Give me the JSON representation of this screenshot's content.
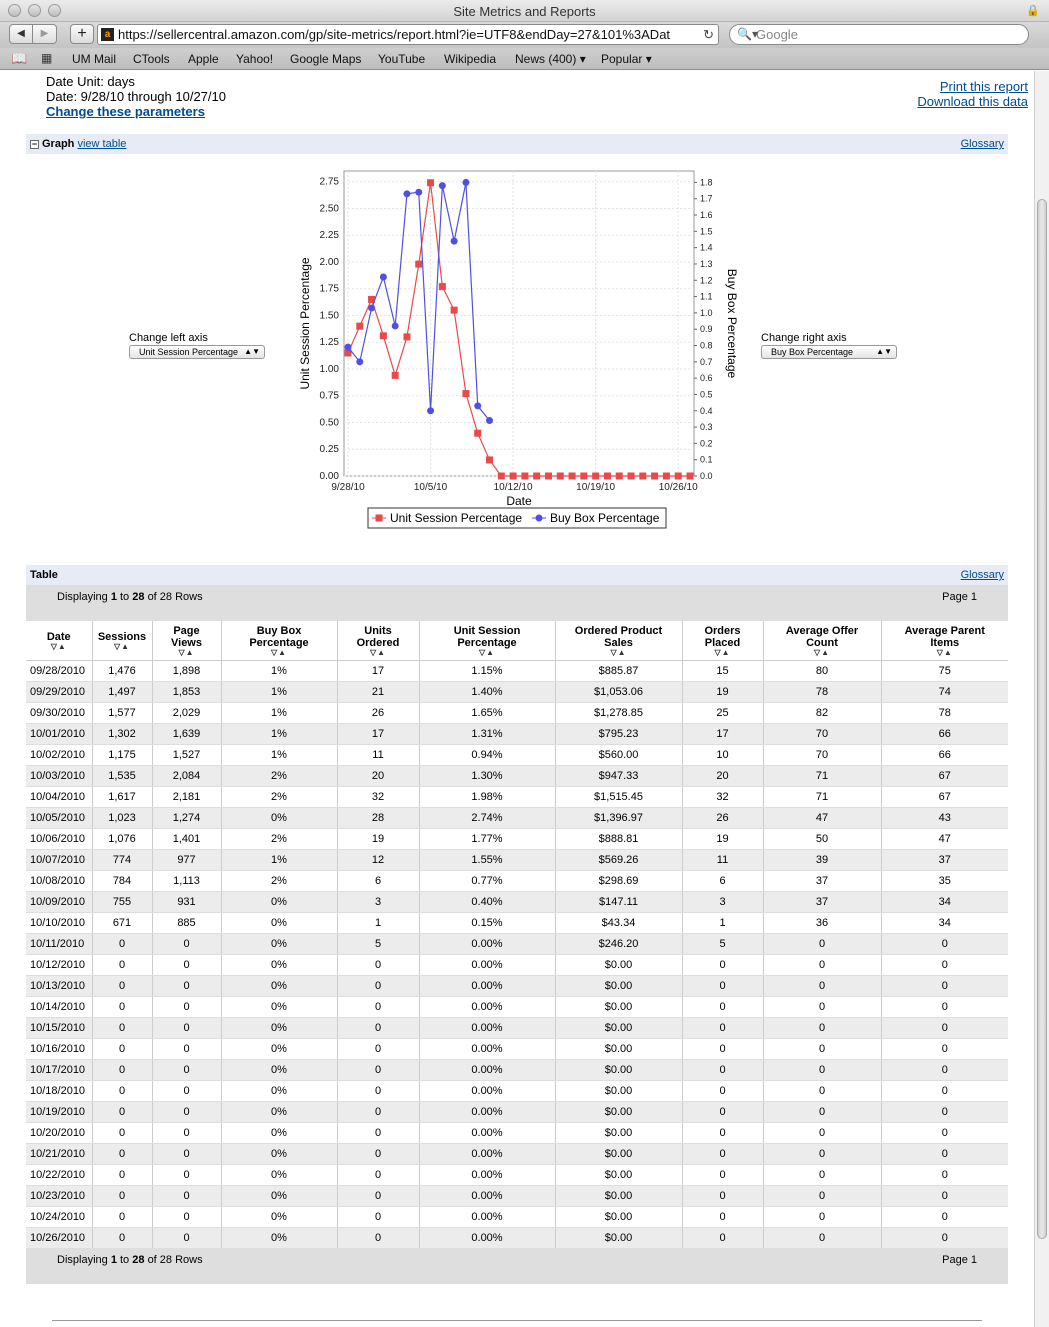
{
  "window": {
    "title": "Site Metrics and Reports"
  },
  "toolbar": {
    "url": "https://sellercentral.amazon.com/gp/site-metrics/report.html?ie=UTF8&endDay=27&101%3ADat",
    "search_placeholder": "Google",
    "back_icon": "back-arrow-icon",
    "forward_icon": "forward-arrow-icon"
  },
  "bookmarks": [
    "UM Mail",
    "CTools",
    "Apple",
    "Yahoo!",
    "Google Maps",
    "YouTube",
    "Wikipedia",
    "News (400) ▾",
    "Popular ▾"
  ],
  "params": {
    "date_unit": "Date Unit: days",
    "date_range": "Date: 9/28/10 through 10/27/10",
    "change_link": "Change these parameters"
  },
  "links": {
    "print": "Print this report",
    "download": "Download this data"
  },
  "graph": {
    "title": "Graph",
    "view_table": "view table",
    "glossary": "Glossary",
    "left_axis_label": "Change left axis",
    "left_axis_value": "Unit Session Percentage",
    "right_axis_label": "Change right axis",
    "right_axis_value": "Buy Box Percentage"
  },
  "chart_data": {
    "type": "line",
    "xlabel": "Date",
    "ylabel": "Unit Session Percentage",
    "y2label": "Buy Box Percentage",
    "x_ticks": [
      "9/28/10",
      "10/5/10",
      "10/12/10",
      "10/19/10",
      "10/26/10"
    ],
    "y_ticks": [
      "0.00",
      "0.25",
      "0.50",
      "0.75",
      "1.00",
      "1.25",
      "1.50",
      "1.75",
      "2.00",
      "2.25",
      "2.50",
      "2.75"
    ],
    "y2_ticks": [
      "0.0",
      "0.1",
      "0.2",
      "0.3",
      "0.4",
      "0.5",
      "0.6",
      "0.7",
      "0.8",
      "0.9",
      "1.0",
      "1.1",
      "1.2",
      "1.3",
      "1.4",
      "1.5",
      "1.6",
      "1.7",
      "1.8"
    ],
    "ylim": [
      0,
      2.85
    ],
    "y2lim": [
      0,
      1.87
    ],
    "x_days": 29,
    "grid": true,
    "legend": "bottom",
    "series": [
      {
        "name": "Unit Session Percentage",
        "axis": "left",
        "color": "#e84a4a",
        "marker": "square",
        "values": [
          1.15,
          1.4,
          1.65,
          1.31,
          0.94,
          1.3,
          1.98,
          2.74,
          1.77,
          1.55,
          0.77,
          0.4,
          0.15,
          0,
          0,
          0,
          0,
          0,
          0,
          0,
          0,
          0,
          0,
          0,
          0,
          0,
          0,
          0,
          0,
          0
        ]
      },
      {
        "name": "Buy Box Percentage",
        "axis": "right",
        "color": "#5050e0",
        "marker": "circle",
        "values": [
          0.79,
          0.7,
          1.03,
          1.22,
          0.92,
          1.73,
          1.74,
          0.4,
          1.78,
          1.44,
          1.8,
          0.43,
          0.34
        ]
      }
    ]
  },
  "table": {
    "title": "Table",
    "glossary": "Glossary",
    "display_prefix": "Displaying",
    "display_from": "1",
    "display_to_word": "to",
    "display_to": "28",
    "display_of": "of 28 Rows",
    "page": "Page 1",
    "headers": [
      [
        "Date"
      ],
      [
        "Sessions"
      ],
      [
        "Page",
        "Views"
      ],
      [
        "Buy Box",
        "Percentage"
      ],
      [
        "Units",
        "Ordered"
      ],
      [
        "Unit Session",
        "Percentage"
      ],
      [
        "Ordered Product",
        "Sales"
      ],
      [
        "Orders",
        "Placed"
      ],
      [
        "Average Offer",
        "Count"
      ],
      [
        "Average Parent",
        "Items"
      ]
    ],
    "rows": [
      [
        "09/28/2010",
        "1,476",
        "1,898",
        "1%",
        "17",
        "1.15%",
        "$885.87",
        "15",
        "80",
        "75"
      ],
      [
        "09/29/2010",
        "1,497",
        "1,853",
        "1%",
        "21",
        "1.40%",
        "$1,053.06",
        "19",
        "78",
        "74"
      ],
      [
        "09/30/2010",
        "1,577",
        "2,029",
        "1%",
        "26",
        "1.65%",
        "$1,278.85",
        "25",
        "82",
        "78"
      ],
      [
        "10/01/2010",
        "1,302",
        "1,639",
        "1%",
        "17",
        "1.31%",
        "$795.23",
        "17",
        "70",
        "66"
      ],
      [
        "10/02/2010",
        "1,175",
        "1,527",
        "1%",
        "11",
        "0.94%",
        "$560.00",
        "10",
        "70",
        "66"
      ],
      [
        "10/03/2010",
        "1,535",
        "2,084",
        "2%",
        "20",
        "1.30%",
        "$947.33",
        "20",
        "71",
        "67"
      ],
      [
        "10/04/2010",
        "1,617",
        "2,181",
        "2%",
        "32",
        "1.98%",
        "$1,515.45",
        "32",
        "71",
        "67"
      ],
      [
        "10/05/2010",
        "1,023",
        "1,274",
        "0%",
        "28",
        "2.74%",
        "$1,396.97",
        "26",
        "47",
        "43"
      ],
      [
        "10/06/2010",
        "1,076",
        "1,401",
        "2%",
        "19",
        "1.77%",
        "$888.81",
        "19",
        "50",
        "47"
      ],
      [
        "10/07/2010",
        "774",
        "977",
        "1%",
        "12",
        "1.55%",
        "$569.26",
        "11",
        "39",
        "37"
      ],
      [
        "10/08/2010",
        "784",
        "1,113",
        "2%",
        "6",
        "0.77%",
        "$298.69",
        "6",
        "37",
        "35"
      ],
      [
        "10/09/2010",
        "755",
        "931",
        "0%",
        "3",
        "0.40%",
        "$147.11",
        "3",
        "37",
        "34"
      ],
      [
        "10/10/2010",
        "671",
        "885",
        "0%",
        "1",
        "0.15%",
        "$43.34",
        "1",
        "36",
        "34"
      ],
      [
        "10/11/2010",
        "0",
        "0",
        "0%",
        "5",
        "0.00%",
        "$246.20",
        "5",
        "0",
        "0"
      ],
      [
        "10/12/2010",
        "0",
        "0",
        "0%",
        "0",
        "0.00%",
        "$0.00",
        "0",
        "0",
        "0"
      ],
      [
        "10/13/2010",
        "0",
        "0",
        "0%",
        "0",
        "0.00%",
        "$0.00",
        "0",
        "0",
        "0"
      ],
      [
        "10/14/2010",
        "0",
        "0",
        "0%",
        "0",
        "0.00%",
        "$0.00",
        "0",
        "0",
        "0"
      ],
      [
        "10/15/2010",
        "0",
        "0",
        "0%",
        "0",
        "0.00%",
        "$0.00",
        "0",
        "0",
        "0"
      ],
      [
        "10/16/2010",
        "0",
        "0",
        "0%",
        "0",
        "0.00%",
        "$0.00",
        "0",
        "0",
        "0"
      ],
      [
        "10/17/2010",
        "0",
        "0",
        "0%",
        "0",
        "0.00%",
        "$0.00",
        "0",
        "0",
        "0"
      ],
      [
        "10/18/2010",
        "0",
        "0",
        "0%",
        "0",
        "0.00%",
        "$0.00",
        "0",
        "0",
        "0"
      ],
      [
        "10/19/2010",
        "0",
        "0",
        "0%",
        "0",
        "0.00%",
        "$0.00",
        "0",
        "0",
        "0"
      ],
      [
        "10/20/2010",
        "0",
        "0",
        "0%",
        "0",
        "0.00%",
        "$0.00",
        "0",
        "0",
        "0"
      ],
      [
        "10/21/2010",
        "0",
        "0",
        "0%",
        "0",
        "0.00%",
        "$0.00",
        "0",
        "0",
        "0"
      ],
      [
        "10/22/2010",
        "0",
        "0",
        "0%",
        "0",
        "0.00%",
        "$0.00",
        "0",
        "0",
        "0"
      ],
      [
        "10/23/2010",
        "0",
        "0",
        "0%",
        "0",
        "0.00%",
        "$0.00",
        "0",
        "0",
        "0"
      ],
      [
        "10/24/2010",
        "0",
        "0",
        "0%",
        "0",
        "0.00%",
        "$0.00",
        "0",
        "0",
        "0"
      ],
      [
        "10/26/2010",
        "0",
        "0",
        "0%",
        "0",
        "0.00%",
        "$0.00",
        "0",
        "0",
        "0"
      ]
    ]
  }
}
